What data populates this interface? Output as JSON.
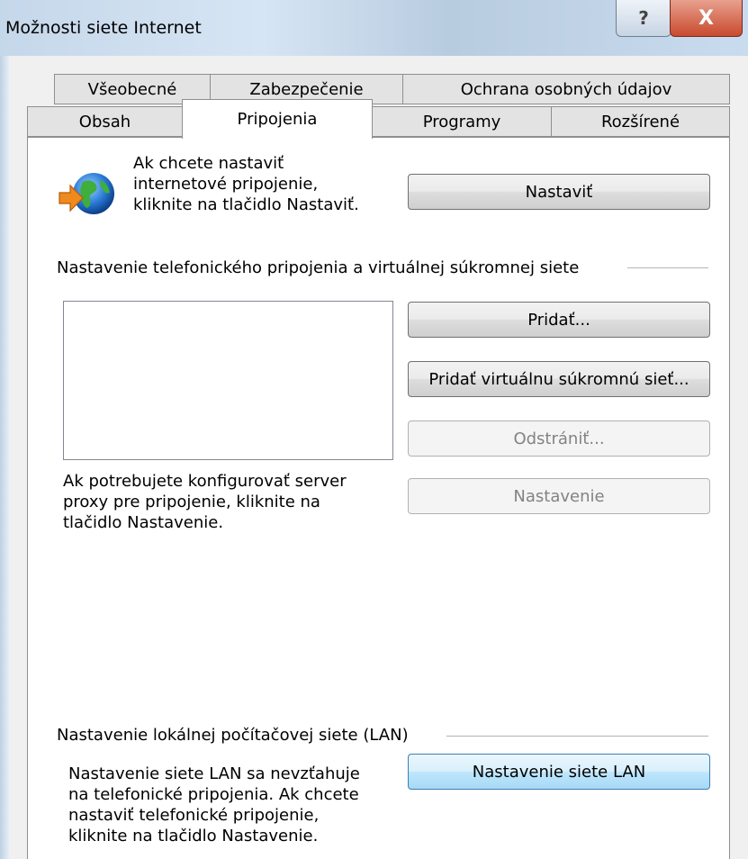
{
  "window": {
    "title": "Možnosti siete Internet",
    "help_glyph": "?",
    "close_glyph": "X"
  },
  "tabs": {
    "row1": [
      "Všeobecné",
      "Zabezpečenie",
      "Ochrana osobných údajov"
    ],
    "row2": [
      "Obsah",
      "Pripojenia",
      "Programy",
      "Rozšírené"
    ],
    "active": "Pripojenia"
  },
  "setup": {
    "icon": "globe-with-arrow-icon",
    "text_lines": [
      "Ak chcete nastaviť",
      "internetové pripojenie,",
      "kliknite na tlačidlo Nastaviť."
    ],
    "button": "Nastaviť"
  },
  "dialup": {
    "group_label": "Nastavenie telefonického pripojenia a virtuálnej súkromnej siete",
    "add_button": "Pridať...",
    "add_vpn_button": "Pridať virtuálnu súkromnú sieť...",
    "remove_button": "Odstrániť...",
    "settings_button": "Nastavenie",
    "proxy_lines": [
      "Ak potrebujete konfigurovať server",
      "proxy pre pripojenie, kliknite na",
      "tlačidlo Nastavenie."
    ]
  },
  "lan": {
    "group_label": "Nastavenie lokálnej počítačovej siete (LAN)",
    "text_lines": [
      "Nastavenie siete LAN sa nevzťahuje",
      "na telefonické pripojenia. Ak chcete",
      "nastaviť telefonické pripojenie,",
      "kliknite na tlačidlo Nastavenie."
    ],
    "button": "Nastavenie siete LAN"
  },
  "colors": {
    "accent": "#3c7fb1",
    "close": "#c84a2e"
  }
}
